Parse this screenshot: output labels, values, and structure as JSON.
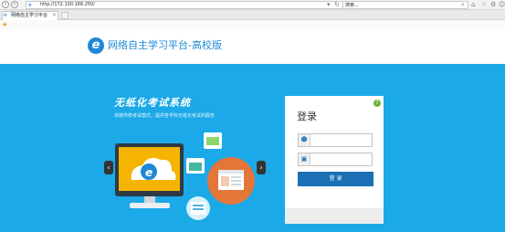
{
  "browser": {
    "url": "http://172.100.166.250/",
    "search_placeholder": "搜索...",
    "tab_title": "网络自主学习平台",
    "tab_close": "×"
  },
  "header": {
    "logo_letter": "e",
    "site_title": "网络自主学习平台-高校版"
  },
  "hero": {
    "slogan": "无纸化考试系统",
    "subslogan": "突破传统考试模式，提供各学科无纸化考试的服务",
    "arrow_left": "‹",
    "arrow_right": "›"
  },
  "login": {
    "title": "登录",
    "help": "?",
    "button": "登 录"
  },
  "colors": {
    "hero_bg": "#1ba9e8",
    "brand_blue": "#1e88d6",
    "button_blue": "#1a6fb5",
    "help_green": "#6db33f"
  },
  "icons": [
    "back-icon",
    "forward-icon",
    "refresh-icon",
    "search-icon",
    "home-icon",
    "star-icon",
    "gear-icon",
    "smiley-icon",
    "user-icon",
    "lock-icon"
  ]
}
